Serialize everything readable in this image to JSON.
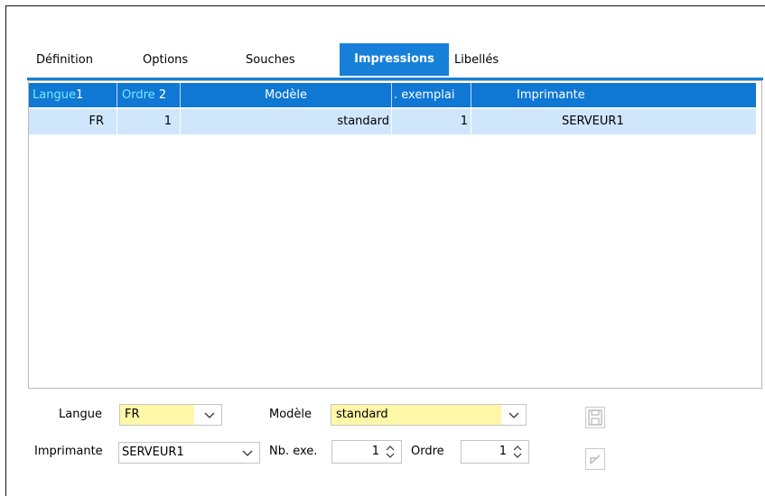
{
  "tabs": [
    {
      "label": "Définition"
    },
    {
      "label": "Options"
    },
    {
      "label": "Souches"
    },
    {
      "label": "Impressions"
    },
    {
      "label": "Libellés"
    }
  ],
  "grid": {
    "columns": [
      "Langue",
      "Ordre",
      "Modèle",
      ". exemplai",
      "Imprimante"
    ],
    "sort_indicators": [
      "1",
      "2"
    ],
    "rows": [
      {
        "langue": "FR",
        "ordre": "1",
        "modele": "standard",
        "exemplaires": "1",
        "imprimante": "SERVEUR1"
      }
    ]
  },
  "form": {
    "langue_label": "Langue",
    "langue_value": "FR",
    "modele_label": "Modèle",
    "modele_value": "standard",
    "imprimante_label": "Imprimante",
    "imprimante_value": "SERVEUR1",
    "nb_exe_label": "Nb. exe.",
    "nb_exe_value": "1",
    "ordre_label": "Ordre",
    "ordre_value": "1"
  },
  "colors": {
    "accent": "#1680d8",
    "header": "#0f78d4",
    "selected_row": "#cfe6fb",
    "field_highlight": "#fff8a8",
    "sorted_text": "#7be6ff"
  },
  "icons": [
    "chevron-down-icon",
    "spin-arrows-icon",
    "save-icon",
    "undo-icon"
  ]
}
